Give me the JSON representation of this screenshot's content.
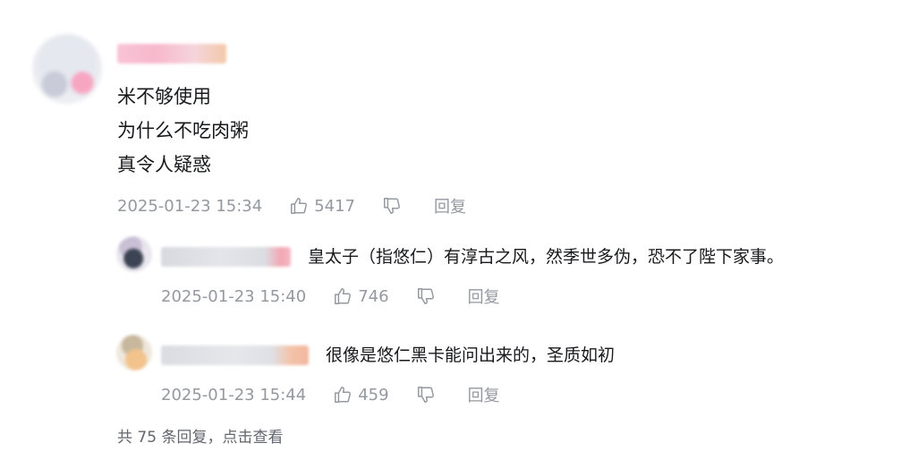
{
  "main_comment": {
    "lines": [
      "米不够使用",
      "为什么不吃肉粥",
      "真令人疑惑"
    ],
    "time": "2025-01-23 15:34",
    "like_count": "5417",
    "reply_label": "回复"
  },
  "replies": [
    {
      "text": "皇太子（指悠仁）有淳古之风，然季世多伪，恐不了陛下家事。",
      "time": "2025-01-23 15:40",
      "like_count": "746",
      "reply_label": "回复"
    },
    {
      "text": "很像是悠仁黑卡能问出来的，圣质如初",
      "time": "2025-01-23 15:44",
      "like_count": "459",
      "reply_label": "回复"
    }
  ],
  "more_replies": "共 75 条回复，点击查看",
  "colors": {
    "meta_text": "#9499a0",
    "body_text": "#18191c"
  },
  "icons": [
    "thumb-up-icon",
    "thumb-down-icon"
  ]
}
